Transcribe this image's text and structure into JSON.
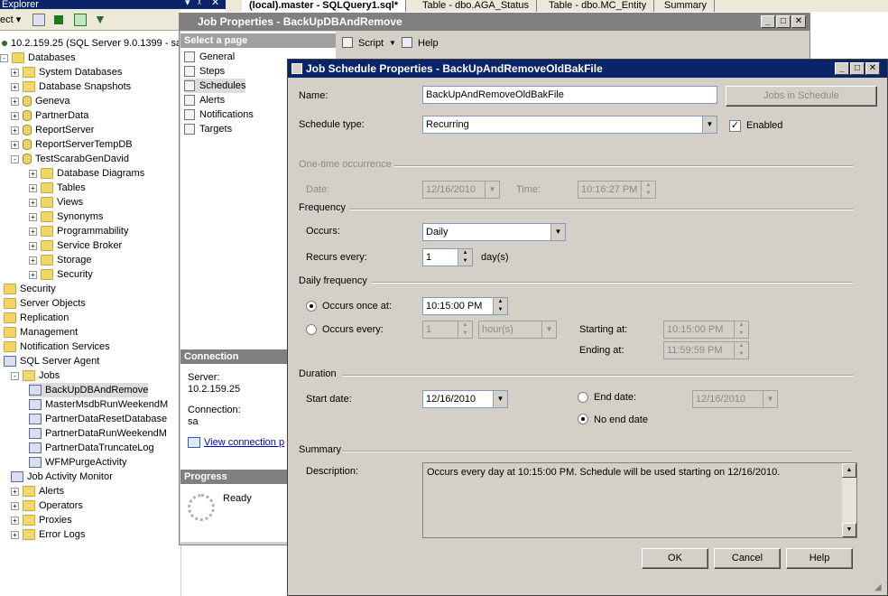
{
  "object_explorer": {
    "title": "Explorer",
    "title_controls": [
      "▾",
      "ᵡ",
      "✕"
    ],
    "toolbar_connect": "ect ▾",
    "server_node": "10.2.159.25 (SQL Server 9.0.1399 - sa",
    "tree": [
      {
        "label": "Databases",
        "level": 0,
        "icon": "folder",
        "exp": "-"
      },
      {
        "label": "System Databases",
        "level": 1,
        "icon": "folder",
        "exp": "+"
      },
      {
        "label": "Database Snapshots",
        "level": 1,
        "icon": "folder",
        "exp": "+"
      },
      {
        "label": "Geneva",
        "level": 1,
        "icon": "db",
        "exp": "+"
      },
      {
        "label": "PartnerData",
        "level": 1,
        "icon": "db",
        "exp": "+"
      },
      {
        "label": "ReportServer",
        "level": 1,
        "icon": "db",
        "exp": "+"
      },
      {
        "label": "ReportServerTempDB",
        "level": 1,
        "icon": "db",
        "exp": "+"
      },
      {
        "label": "TestScarabGenDavid",
        "level": 1,
        "icon": "db",
        "exp": "-"
      },
      {
        "label": "Database Diagrams",
        "level": 2,
        "icon": "folder",
        "exp": "+"
      },
      {
        "label": "Tables",
        "level": 2,
        "icon": "folder",
        "exp": "+"
      },
      {
        "label": "Views",
        "level": 2,
        "icon": "folder",
        "exp": "+"
      },
      {
        "label": "Synonyms",
        "level": 2,
        "icon": "folder",
        "exp": "+"
      },
      {
        "label": "Programmability",
        "level": 2,
        "icon": "folder",
        "exp": "+"
      },
      {
        "label": "Service Broker",
        "level": 2,
        "icon": "folder",
        "exp": "+"
      },
      {
        "label": "Storage",
        "level": 2,
        "icon": "folder",
        "exp": "+"
      },
      {
        "label": "Security",
        "level": 2,
        "icon": "folder",
        "exp": "+"
      },
      {
        "label": "Security",
        "level": 0,
        "icon": "folder",
        "exp": ""
      },
      {
        "label": "Server Objects",
        "level": 0,
        "icon": "folder",
        "exp": ""
      },
      {
        "label": "Replication",
        "level": 0,
        "icon": "folder",
        "exp": ""
      },
      {
        "label": "Management",
        "level": 0,
        "icon": "folder",
        "exp": ""
      },
      {
        "label": "Notification Services",
        "level": 0,
        "icon": "folder",
        "exp": ""
      },
      {
        "label": "SQL Server Agent",
        "level": 0,
        "icon": "agent",
        "exp": ""
      },
      {
        "label": "Jobs",
        "level": 1,
        "icon": "folder",
        "exp": "-"
      },
      {
        "label": "BackUpDBAndRemove",
        "level": 2,
        "icon": "job",
        "exp": "",
        "selected": true
      },
      {
        "label": "MasterMsdbRunWeekendM",
        "level": 2,
        "icon": "job",
        "exp": ""
      },
      {
        "label": "PartnerDataResetDatabase",
        "level": 2,
        "icon": "job",
        "exp": ""
      },
      {
        "label": "PartnerDataRunWeekendM",
        "level": 2,
        "icon": "job",
        "exp": ""
      },
      {
        "label": "PartnerDataTruncateLog",
        "level": 2,
        "icon": "job",
        "exp": ""
      },
      {
        "label": "WFMPurgeActivity",
        "level": 2,
        "icon": "job",
        "exp": ""
      },
      {
        "label": "Job Activity Monitor",
        "level": 1,
        "icon": "monitor",
        "exp": ""
      },
      {
        "label": "Alerts",
        "level": 1,
        "icon": "folder",
        "exp": "+"
      },
      {
        "label": "Operators",
        "level": 1,
        "icon": "folder",
        "exp": "+"
      },
      {
        "label": "Proxies",
        "level": 1,
        "icon": "folder",
        "exp": "+"
      },
      {
        "label": "Error Logs",
        "level": 1,
        "icon": "folder",
        "exp": "+"
      }
    ]
  },
  "tabs": [
    {
      "label": "(local).master - SQLQuery1.sql*",
      "active": true
    },
    {
      "label": "Table - dbo.AGA_Status",
      "active": false
    },
    {
      "label": "Table - dbo.MC_Entity",
      "active": false
    },
    {
      "label": "Summary",
      "active": false
    }
  ],
  "job_properties": {
    "title": "Job Properties - BackUpDBAndRemove",
    "select_page": "Select a page",
    "pages": [
      "General",
      "Steps",
      "Schedules",
      "Alerts",
      "Notifications",
      "Targets"
    ],
    "selected_page": "Schedules",
    "toolbar": {
      "script": "Script",
      "help": "Help"
    },
    "connection_header": "Connection",
    "server_label": "Server:",
    "server_value": "10.2.159.25",
    "connection_label": "Connection:",
    "connection_value": "sa",
    "view_connection": "View connection p",
    "progress_header": "Progress",
    "progress_status": "Ready"
  },
  "schedule": {
    "title": "Job Schedule Properties - BackUpAndRemoveOldBakFile",
    "name_label": "Name:",
    "name_value": "BackUpAndRemoveOldBakFile",
    "jobs_in_schedule": "Jobs in Schedule",
    "schedule_type_label": "Schedule type:",
    "schedule_type_value": "Recurring",
    "enabled_label": "Enabled",
    "enabled": true,
    "onetime_header": "One-time occurrence",
    "date_label": "Date:",
    "date_value": "12/16/2010",
    "time_label": "Time:",
    "time_value": "10:16:27 PM",
    "frequency_header": "Frequency",
    "occurs_label": "Occurs:",
    "occurs_value": "Daily",
    "recurs_label": "Recurs every:",
    "recurs_value": "1",
    "recurs_unit": "day(s)",
    "daily_header": "Daily frequency",
    "once_at_label": "Occurs once at:",
    "once_at_value": "10:15:00 PM",
    "every_label": "Occurs every:",
    "every_value": "1",
    "every_unit": "hour(s)",
    "starting_label": "Starting at:",
    "starting_value": "10:15:00 PM",
    "ending_label": "Ending at:",
    "ending_value": "11:59:59 PM",
    "duration_header": "Duration",
    "start_date_label": "Start date:",
    "start_date_value": "12/16/2010",
    "end_date_label": "End date:",
    "end_date_value": "12/16/2010",
    "no_end_label": "No end date",
    "summary_header": "Summary",
    "description_label": "Description:",
    "description_value": "Occurs every day at 10:15:00 PM. Schedule will be used starting on 12/16/2010.",
    "ok": "OK",
    "cancel": "Cancel",
    "help": "Help"
  }
}
